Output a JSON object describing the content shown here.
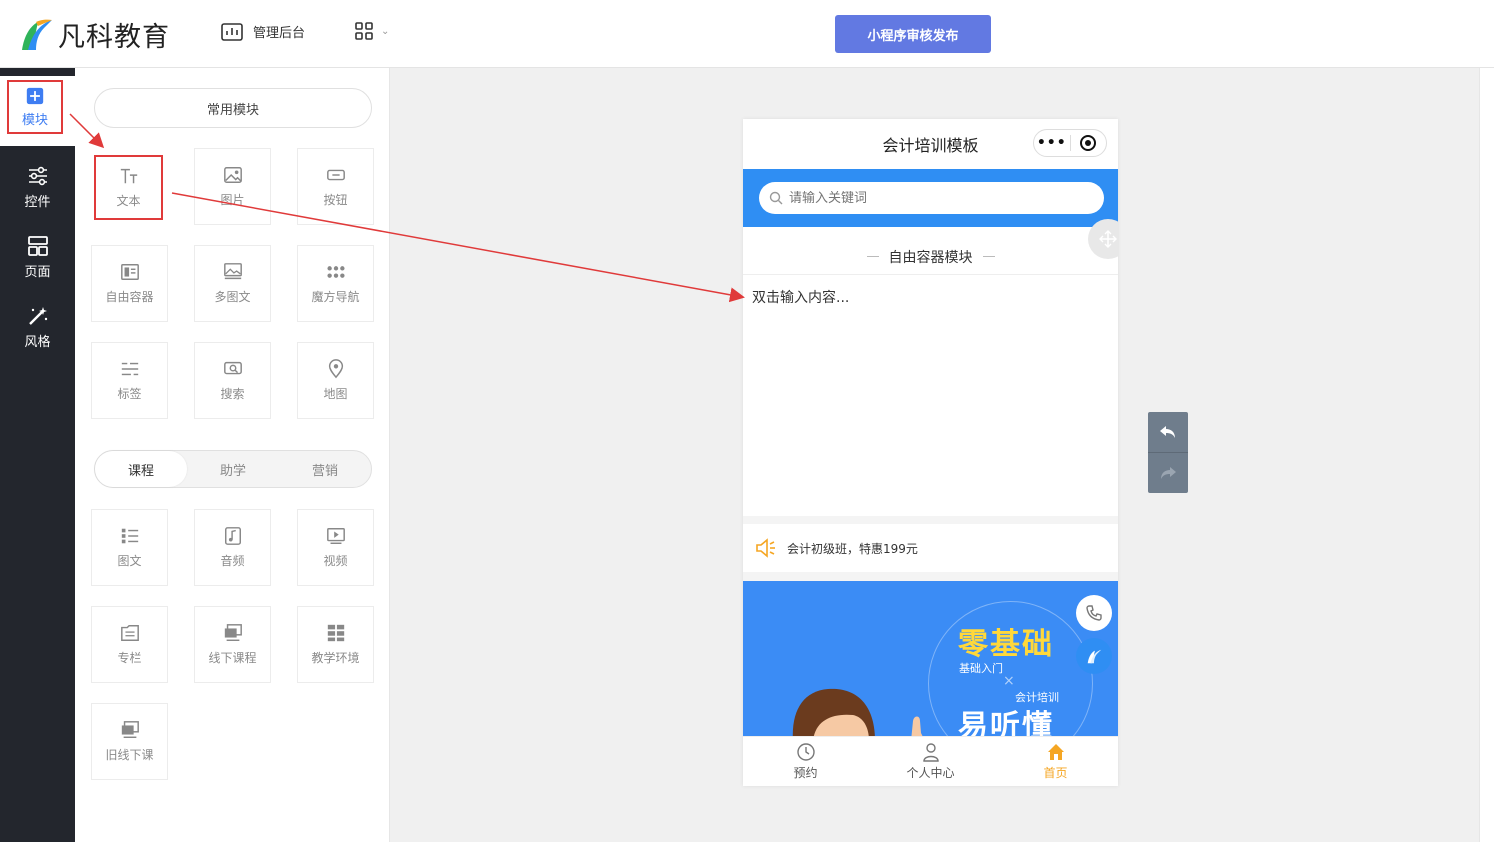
{
  "header": {
    "brand": "凡科教育",
    "nav_label": "管理后台",
    "publish_label": "小程序审核发布"
  },
  "sidebar": {
    "items": [
      {
        "label": "模块",
        "icon": "plus-square-icon",
        "active": true
      },
      {
        "label": "控件",
        "icon": "sliders-icon"
      },
      {
        "label": "页面",
        "icon": "page-layout-icon"
      },
      {
        "label": "风格",
        "icon": "magic-wand-icon"
      }
    ]
  },
  "panel": {
    "common_title": "常用模块",
    "common_tiles": [
      {
        "label": "文本",
        "icon": "text-icon"
      },
      {
        "label": "图片",
        "icon": "image-icon"
      },
      {
        "label": "按钮",
        "icon": "button-icon"
      },
      {
        "label": "自由容器",
        "icon": "container-icon"
      },
      {
        "label": "多图文",
        "icon": "multi-image-icon"
      },
      {
        "label": "魔方导航",
        "icon": "dots-grid-icon"
      },
      {
        "label": "标签",
        "icon": "tag-lines-icon"
      },
      {
        "label": "搜索",
        "icon": "search-icon"
      },
      {
        "label": "地图",
        "icon": "map-pin-icon"
      }
    ],
    "segments": [
      "课程",
      "助学",
      "营销"
    ],
    "course_tiles": [
      {
        "label": "图文",
        "icon": "list-icon"
      },
      {
        "label": "音频",
        "icon": "music-note-icon"
      },
      {
        "label": "视频",
        "icon": "video-icon"
      },
      {
        "label": "专栏",
        "icon": "column-icon"
      },
      {
        "label": "线下课程",
        "icon": "offline-course-icon"
      },
      {
        "label": "教学环境",
        "icon": "environment-grid-icon"
      },
      {
        "label": "旧线下课",
        "icon": "old-course-icon"
      }
    ]
  },
  "phone": {
    "title": "会计培训模板",
    "search_placeholder": "请输入关键词",
    "free_container_title": "自由容器模块",
    "free_container_text": "双击输入内容...",
    "notice": "会计初级班，特惠199元",
    "banner": {
      "line1": "零基础",
      "line2": "基础入门",
      "line3": "会计培训",
      "line4": "易听懂"
    },
    "tabs": [
      {
        "label": "预约",
        "icon": "clock-icon"
      },
      {
        "label": "个人中心",
        "icon": "user-icon"
      },
      {
        "label": "首页",
        "icon": "home-icon",
        "active": true
      }
    ]
  },
  "colors": {
    "primary": "#6279e2",
    "accent_blue": "#2f8ef3",
    "sidebar_bg": "#23262d",
    "highlight_red": "#e03a3a",
    "tab_active": "#f5a623"
  }
}
